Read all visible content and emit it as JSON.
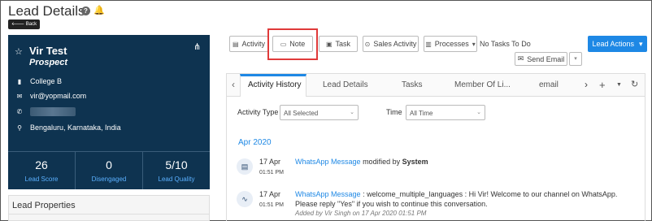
{
  "header": {
    "title": "Lead Details",
    "back_label": "🡐 Back",
    "icons": [
      "help-icon",
      "bell-icon"
    ]
  },
  "profile": {
    "name": "Vir Test",
    "stage": "Prospect",
    "company": "College B",
    "email": "vir@yopmail.com",
    "location": "Bengaluru, Karnataka, India",
    "stats": [
      {
        "value": "26",
        "label": "Lead Score"
      },
      {
        "value": "0",
        "label": "Disengaged"
      },
      {
        "value": "5/10",
        "label": "Lead Quality"
      }
    ]
  },
  "lead_properties": {
    "title": "Lead Properties"
  },
  "toolbar": {
    "activity_label": "Activity",
    "note_label": "Note",
    "task_label": "Task",
    "sales_activity_label": "Sales Activity",
    "processes_label": "Processes",
    "no_tasks_label": "No Tasks To Do",
    "lead_actions_label": "Lead Actions",
    "send_email_label": "Send Email"
  },
  "tabs": [
    {
      "label": "Activity History",
      "active": true
    },
    {
      "label": "Lead Details"
    },
    {
      "label": "Tasks"
    },
    {
      "label": "Member Of Li..."
    },
    {
      "label": "email"
    }
  ],
  "filters": {
    "activity_type_label": "Activity Type",
    "activity_type_value": "All Selected",
    "time_label": "Time",
    "time_value": "All Time"
  },
  "timeline": {
    "date_heading": "Apr 2020",
    "items": [
      {
        "date": "17 Apr",
        "time": "01:51 PM",
        "type": "WhatsApp Message",
        "text": "modified by",
        "actor": "System"
      },
      {
        "date": "17 Apr",
        "time": "01:51 PM",
        "type": "WhatsApp Message",
        "text": ": welcome_multiple_languages : Hi Vir! Welcome to our channel on WhatsApp.",
        "text2": "Please reply \"Yes\" if you wish to continue this conversation.",
        "meta": "Added by Vir Singh on 17 Apr 2020 01:51 PM"
      }
    ]
  },
  "colors": {
    "profile_bg": "#0e3350",
    "accent": "#1e88e5",
    "highlight": "#e03a3a"
  }
}
